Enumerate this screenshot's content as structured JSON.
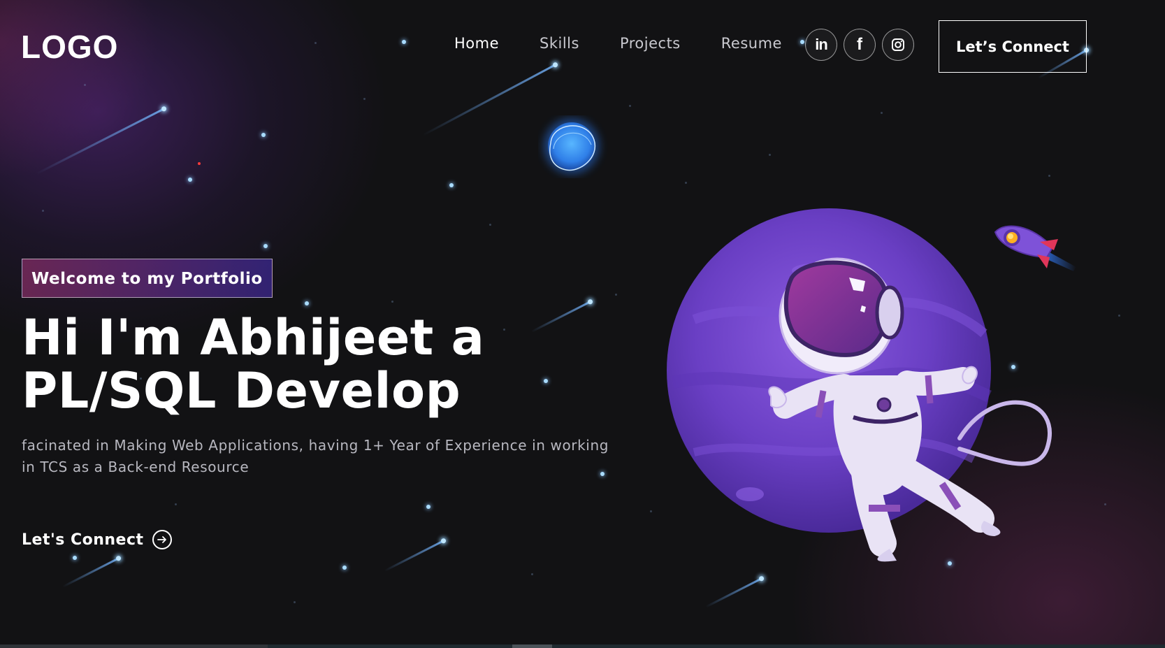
{
  "nav": {
    "logo": "LOGO",
    "links": [
      "Home",
      "Skills",
      "Projects",
      "Resume"
    ],
    "socials": [
      {
        "icon": "linkedin-icon",
        "glyph": "in"
      },
      {
        "icon": "facebook-icon",
        "glyph": "f"
      },
      {
        "icon": "instagram-icon",
        "glyph": ""
      }
    ],
    "connect_label": "Let’s Connect"
  },
  "hero": {
    "tagline": "Welcome to my Portfolio",
    "title": "Hi I'm Abhijeet a PL/SQL Develop",
    "description": "facinated in Making Web Applications, having 1+ Year of Experience in working in TCS as a Back-end Resource",
    "cta_label": "Let's Connect"
  },
  "colors": {
    "background": "#121214",
    "tagline_gradient_start": "#aa367c",
    "tagline_gradient_end": "#4a2fbd",
    "planet": "#6a3fc4",
    "star": "#a9dcff"
  }
}
